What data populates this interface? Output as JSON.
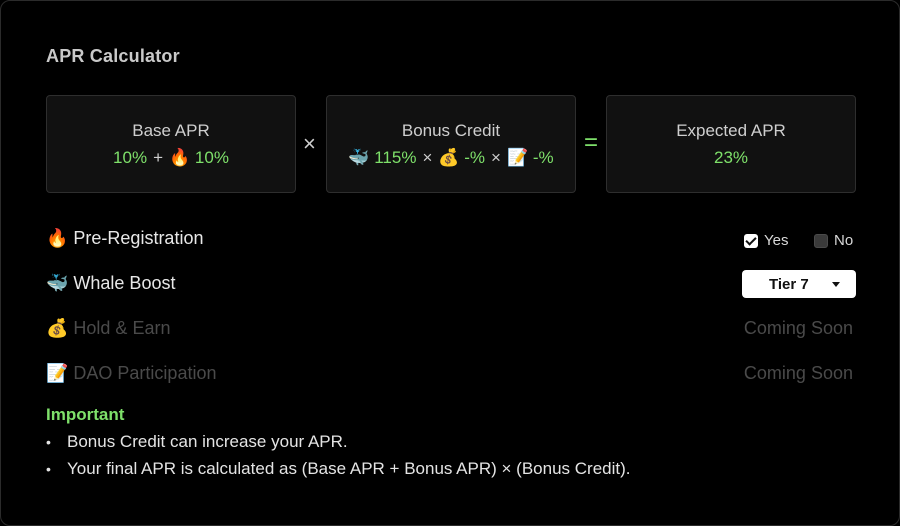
{
  "title": "APR Calculator",
  "cards": [
    {
      "label": "Base APR",
      "value_parts": [
        "10%",
        "+",
        "🔥 10%"
      ]
    },
    {
      "label": "Bonus Credit",
      "value_parts": [
        "🐳 115%",
        "×",
        "💰 -%",
        "×",
        "📝 -%"
      ]
    },
    {
      "label": "Expected APR",
      "value_parts": [
        "23%"
      ]
    }
  ],
  "operators": {
    "multiply": "×",
    "equals": "="
  },
  "rows": {
    "pre_registration": {
      "label": "🔥 Pre-Registration",
      "yes_label": "Yes",
      "no_label": "No",
      "yes_checked": true,
      "no_checked": false
    },
    "whale_boost": {
      "label": "🐳 Whale Boost",
      "selected": "Tier 7"
    },
    "hold_earn": {
      "label": "💰 Hold & Earn",
      "status": "Coming Soon"
    },
    "dao": {
      "label": "📝 DAO Participation",
      "status": "Coming Soon"
    }
  },
  "important": {
    "title": "Important",
    "items": [
      "Bonus Credit can increase your APR.",
      "Your final APR is calculated as (Base APR + Bonus APR) × (Bonus Credit)."
    ]
  },
  "colors": {
    "accent_green": "#7ee06a",
    "background": "#000000",
    "card_bg": "#111111"
  }
}
